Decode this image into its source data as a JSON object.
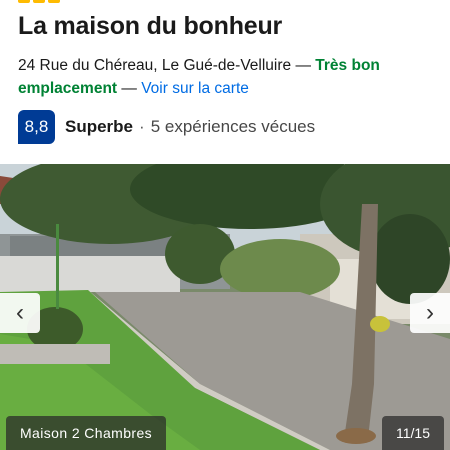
{
  "property": {
    "star_count": 3,
    "title": "La maison du bonheur",
    "address": "24 Rue du Chéreau, Le Gué-de-Velluire",
    "separator": "—",
    "location_badge": "Très bon emplacement",
    "map_link": "Voir sur la carte"
  },
  "rating": {
    "score": "8,8",
    "label": "Superbe",
    "separator": "·",
    "reviews": "5 expériences vécues"
  },
  "gallery": {
    "caption": "Maison 2 Chambres",
    "counter": "11/15",
    "prev_icon": "chevron-left-icon",
    "next_icon": "chevron-right-icon",
    "prev_glyph": "‹",
    "next_glyph": "›"
  },
  "colors": {
    "score_bg": "#003b95",
    "badge_green": "#008234",
    "link_blue": "#006ce4",
    "star_yellow": "#febb02"
  }
}
